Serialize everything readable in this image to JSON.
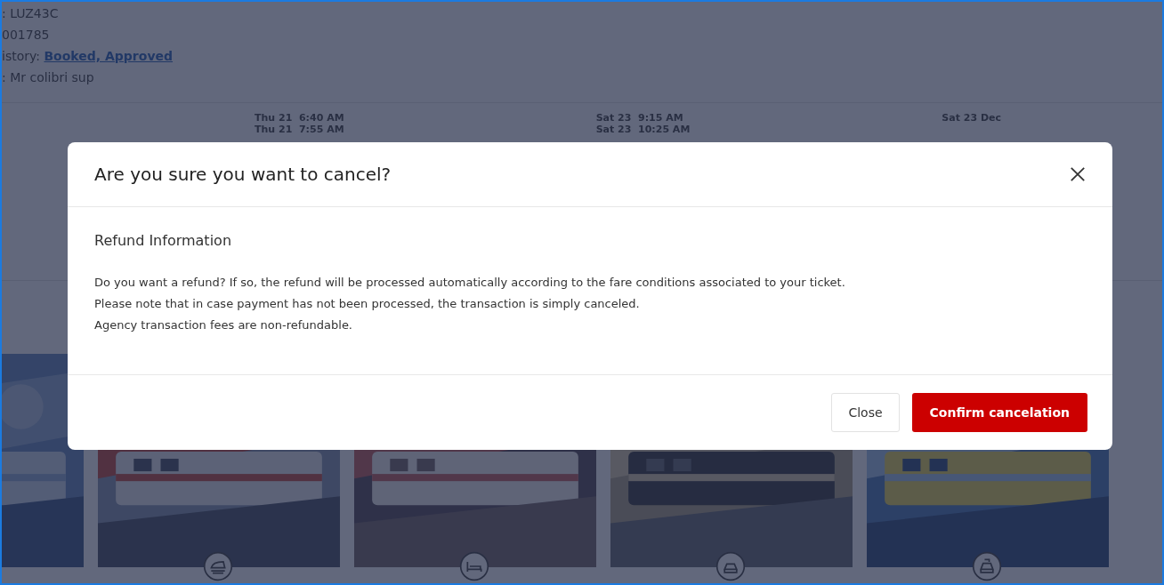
{
  "booking_info": [
    {
      "text": ": LUZ43C"
    },
    {
      "text": "001785"
    },
    {
      "text": "istory: ",
      "link": "Booked, Approved"
    },
    {
      "text": ": Mr colibri sup"
    }
  ],
  "timeline": [
    {
      "lines": [
        "Thu 21  6:40 AM",
        "Thu 21  7:55 AM"
      ]
    },
    {
      "lines": [
        "Sat 23  9:15 AM",
        "Sat 23  10:25 AM"
      ]
    },
    {
      "lines": [
        "Sat 23 Dec"
      ]
    }
  ],
  "dialog": {
    "title": "Are you sure you want to cancel?",
    "section_title": "Refund Information",
    "paragraphs": [
      "Do you want a refund? If so, the refund will be processed automatically according to the fare conditions associated to your ticket.",
      "Please note that in case payment has not been processed, the transaction is simply canceled.",
      "Agency transaction fees are non-refundable."
    ],
    "buttons": [
      {
        "label": "Close",
        "kind": "secondary"
      },
      {
        "label": "Confirm cancelation",
        "kind": "primary"
      }
    ]
  }
}
